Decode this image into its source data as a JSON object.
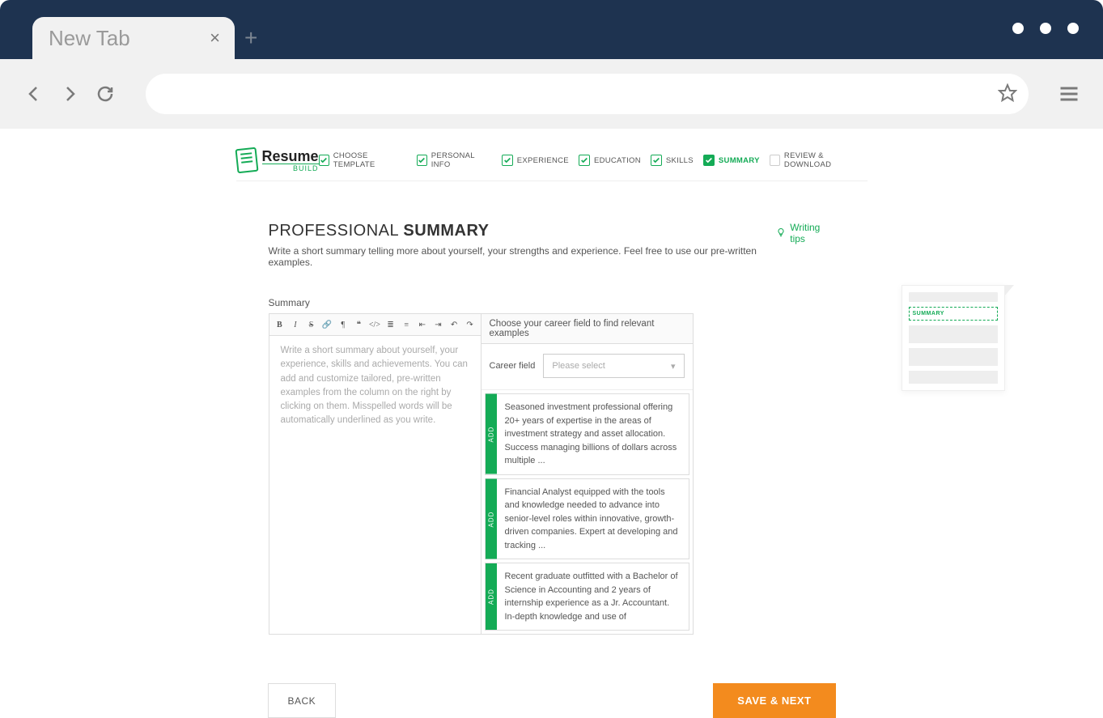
{
  "browser": {
    "tab_title": "New Tab",
    "tab_close": "×",
    "new_tab": "+"
  },
  "logo": {
    "name": "Resume",
    "sub": "BUILD"
  },
  "steps": [
    {
      "label": "CHOOSE TEMPLATE",
      "checked": true,
      "filled": false,
      "active": false
    },
    {
      "label": "PERSONAL INFO",
      "checked": true,
      "filled": false,
      "active": false
    },
    {
      "label": "EXPERIENCE",
      "checked": true,
      "filled": false,
      "active": false
    },
    {
      "label": "EDUCATION",
      "checked": true,
      "filled": false,
      "active": false
    },
    {
      "label": "SKILLS",
      "checked": true,
      "filled": false,
      "active": false
    },
    {
      "label": "SUMMARY",
      "checked": true,
      "filled": true,
      "active": true
    },
    {
      "label": "REVIEW & DOWNLOAD",
      "checked": false,
      "filled": false,
      "active": false
    }
  ],
  "page": {
    "title_light": "PROFESSIONAL ",
    "title_bold": "SUMMARY",
    "subtitle": "Write a short summary telling more about yourself, your strengths and experience. Feel free to use our pre-written examples.",
    "tips": "Writing tips",
    "summary_label": "Summary",
    "editor_placeholder": "Write a short summary about yourself, your experience, skills and achievements. You can add and customize tailored, pre-written examples from the column on the right by clicking on them. Misspelled words will be automatically underlined as you write.",
    "right_header": "Choose your career field to find relevant examples",
    "career_label": "Career field",
    "career_placeholder": "Please select",
    "add_label": "ADD",
    "examples": [
      "Seasoned investment professional offering 20+ years of expertise in the areas of investment strategy and asset allocation. Success managing billions of dollars across multiple ...",
      "Financial Analyst equipped with the tools and knowledge needed to advance into senior-level roles within innovative, growth-driven companies. Expert at developing and tracking ...",
      "Recent graduate outfitted with a Bachelor of Science in Accounting and 2 years of internship experience as a Jr. Accountant. In-depth knowledge and use of"
    ],
    "preview_label": "SUMMARY",
    "back": "BACK",
    "next": "SAVE & NEXT"
  },
  "toolbar_icons": [
    "B",
    "I",
    "S",
    "🔗",
    "¶",
    "❝",
    "</>",
    "≣",
    "≡",
    "⇤",
    "⇥",
    "↶",
    "↷"
  ]
}
